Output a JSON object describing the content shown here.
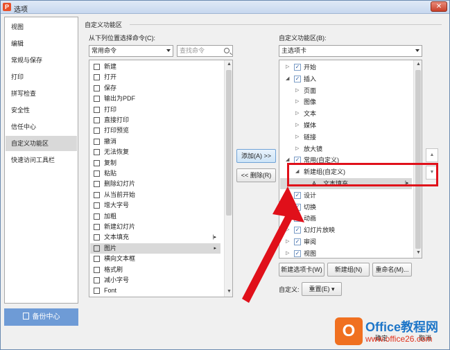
{
  "window": {
    "title": "选项",
    "title_icon": "P",
    "close": "✕"
  },
  "nav": {
    "items": [
      "视图",
      "编辑",
      "常规与保存",
      "打印",
      "拼写检查",
      "安全性",
      "信任中心",
      "自定义功能区",
      "快速访问工具栏"
    ],
    "active_index": 7,
    "backup_label": "备份中心"
  },
  "section_title": "自定义功能区",
  "left": {
    "label": "从下列位置选择命令(C):",
    "dropdown_value": "常用命令",
    "search_placeholder": "查找命令",
    "commands": [
      {
        "label": "新建",
        "icon": "new-doc-icon"
      },
      {
        "label": "打开",
        "icon": "open-folder-icon"
      },
      {
        "label": "保存",
        "icon": "save-icon"
      },
      {
        "label": "输出为PDF",
        "icon": "pdf-icon"
      },
      {
        "label": "打印",
        "icon": "print-icon"
      },
      {
        "label": "直接打印",
        "icon": "direct-print-icon"
      },
      {
        "label": "打印预览",
        "icon": "print-preview-icon"
      },
      {
        "label": "撤消",
        "icon": "undo-icon"
      },
      {
        "label": "无法恢复",
        "icon": "redo-icon"
      },
      {
        "label": "复制",
        "icon": "copy-icon"
      },
      {
        "label": "粘贴",
        "icon": "paste-icon"
      },
      {
        "label": "删除幻灯片",
        "icon": "delete-slide-icon"
      },
      {
        "label": "从当前开始",
        "icon": "play-from-current-icon"
      },
      {
        "label": "增大字号",
        "icon": "increase-font-icon"
      },
      {
        "label": "加粗",
        "icon": "bold-icon"
      },
      {
        "label": "新建幻灯片",
        "icon": "new-slide-icon"
      },
      {
        "label": "文本填充",
        "icon": "text-fill-icon"
      },
      {
        "label": "图片",
        "icon": "picture-icon"
      },
      {
        "label": "横向文本框",
        "icon": "textbox-icon"
      },
      {
        "label": "格式刷",
        "icon": "format-painter-icon"
      },
      {
        "label": "减小字号",
        "icon": "decrease-font-icon"
      },
      {
        "label": "Font",
        "icon": "font-icon"
      }
    ]
  },
  "middle": {
    "add_label": "添加(A) >>",
    "remove_label": "<< 删除(R)"
  },
  "right": {
    "label": "自定义功能区(B):",
    "dropdown_value": "主选项卡",
    "tree": [
      {
        "label": "开始",
        "level": 1,
        "exp": "▷",
        "check": true
      },
      {
        "label": "插入",
        "level": 1,
        "exp": "◢",
        "check": true
      },
      {
        "label": "页面",
        "level": 2,
        "exp": "▷"
      },
      {
        "label": "图像",
        "level": 2,
        "exp": "▷"
      },
      {
        "label": "文本",
        "level": 2,
        "exp": "▷"
      },
      {
        "label": "媒体",
        "level": 2,
        "exp": "▷"
      },
      {
        "label": "链接",
        "level": 2,
        "exp": "▷"
      },
      {
        "label": "放大镜",
        "level": 2,
        "exp": "▷"
      },
      {
        "label": "常用(自定义)",
        "level": 1,
        "exp": "◢",
        "check": true
      },
      {
        "label": "新建组(自定义)",
        "level": 2,
        "exp": "◢"
      },
      {
        "label": "文本填充",
        "level": 3,
        "exp": ""
      },
      {
        "label": "设计",
        "level": 1,
        "exp": "▷",
        "check": true
      },
      {
        "label": "切换",
        "level": 1,
        "exp": "▷",
        "check": true
      },
      {
        "label": "动画",
        "level": 1,
        "exp": "▷",
        "check": true
      },
      {
        "label": "幻灯片放映",
        "level": 1,
        "exp": "▷",
        "check": true
      },
      {
        "label": "审阅",
        "level": 1,
        "exp": "▷",
        "check": true
      },
      {
        "label": "视图",
        "level": 1,
        "exp": "▷",
        "check": true
      }
    ],
    "new_tab_label": "新建选项卡(W)",
    "new_group_label": "新建组(N)",
    "rename_label": "重命名(M)...",
    "custom_label": "自定义:",
    "reset_label": "重置(E)"
  },
  "footer": {
    "ok": "确定",
    "cancel": "取消"
  },
  "watermark": {
    "logo": "O",
    "title": "Office教程网",
    "url": "www.office26.com"
  },
  "colors": {
    "highlight": "#e0101a",
    "accent": "#6e9bd6"
  }
}
